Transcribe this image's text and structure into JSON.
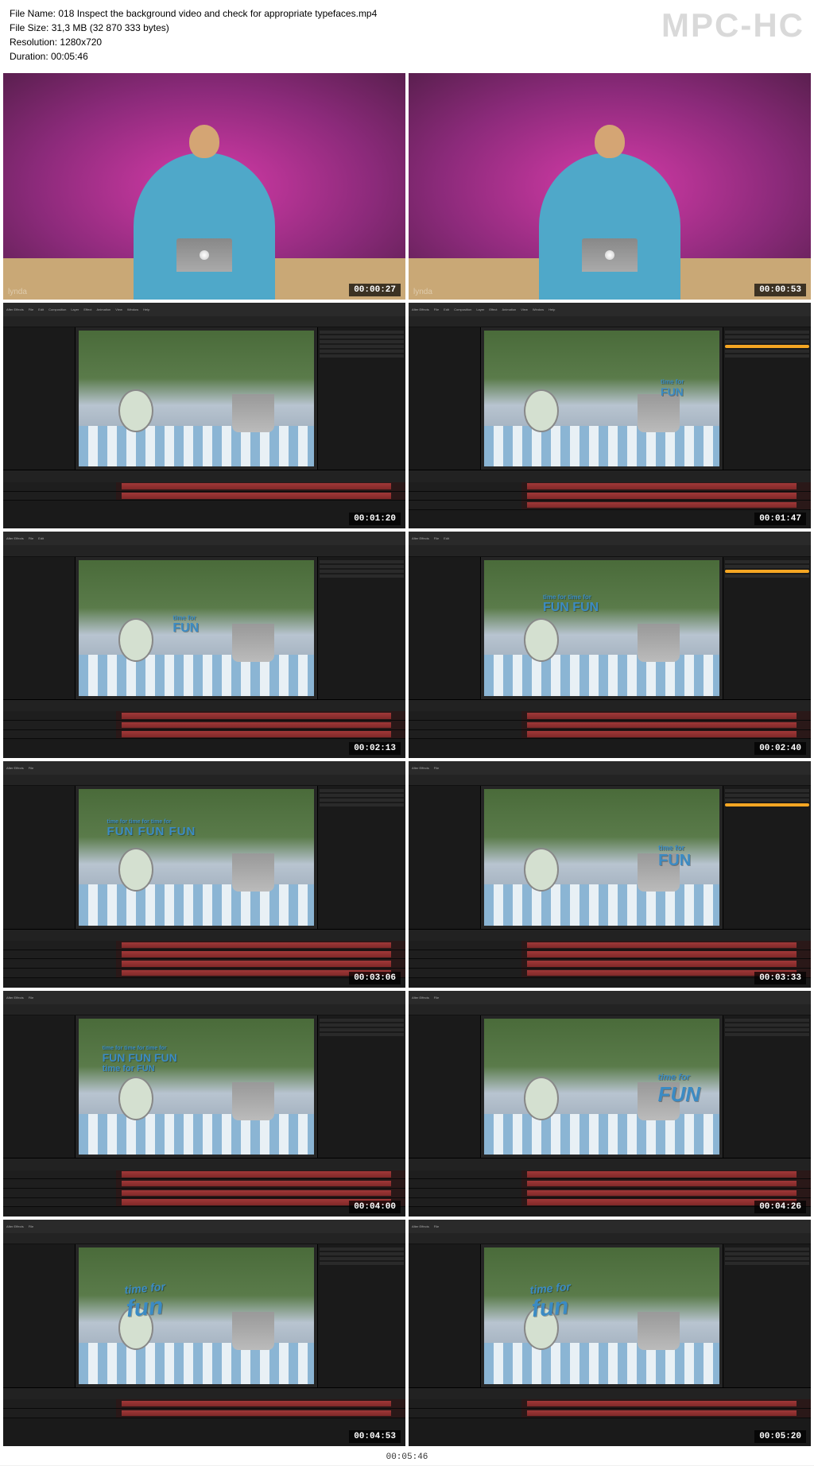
{
  "watermark": "MPC-HC",
  "file_info": {
    "name_label": "File Name:",
    "name": "018 Inspect the background video and check for appropriate typefaces.mp4",
    "size_label": "File Size:",
    "size": "31,3 MB (32 870 333 bytes)",
    "resolution_label": "Resolution:",
    "resolution": "1280x720",
    "duration_label": "Duration:",
    "duration": "00:05:46"
  },
  "footer_timestamp": "00:05:46",
  "lynda_brand": "lynda",
  "ae_menus": [
    "After Effects",
    "File",
    "Edit",
    "Composition",
    "Layer",
    "Effect",
    "Animation",
    "View",
    "Window",
    "Help"
  ],
  "thumbnails": [
    {
      "type": "presenter",
      "ts": "00:00:27"
    },
    {
      "type": "presenter",
      "ts": "00:00:53"
    },
    {
      "type": "ae",
      "ts": "00:01:20",
      "text": "",
      "variant": 1
    },
    {
      "type": "ae",
      "ts": "00:01:47",
      "text": "time for FUN",
      "variant": 1,
      "highlight": "right"
    },
    {
      "type": "ae",
      "ts": "00:02:13",
      "text": "time for FUN",
      "variant": 1
    },
    {
      "type": "ae",
      "ts": "00:02:40",
      "text": "time for FUN FUN",
      "variant": 2,
      "highlight": "right"
    },
    {
      "type": "ae",
      "ts": "00:03:06",
      "text": "FUN FUN FUN",
      "variant": 3
    },
    {
      "type": "ae",
      "ts": "00:03:33",
      "text": "time for FUN",
      "variant": 3,
      "highlight": "right"
    },
    {
      "type": "ae",
      "ts": "00:04:00",
      "text": "FUN FUN FUN",
      "variant": 3
    },
    {
      "type": "ae",
      "ts": "00:04:26",
      "text": "time for FUN",
      "variant": 4
    },
    {
      "type": "ae",
      "ts": "00:04:53",
      "text": "time for fun",
      "variant": 5
    },
    {
      "type": "ae",
      "ts": "00:05:20",
      "text": "time for fun",
      "variant": 5
    }
  ],
  "fun_texts": {
    "t1": "time for",
    "t2": "FUN",
    "t3": "FUN FUN",
    "t4": "time for FUN"
  }
}
